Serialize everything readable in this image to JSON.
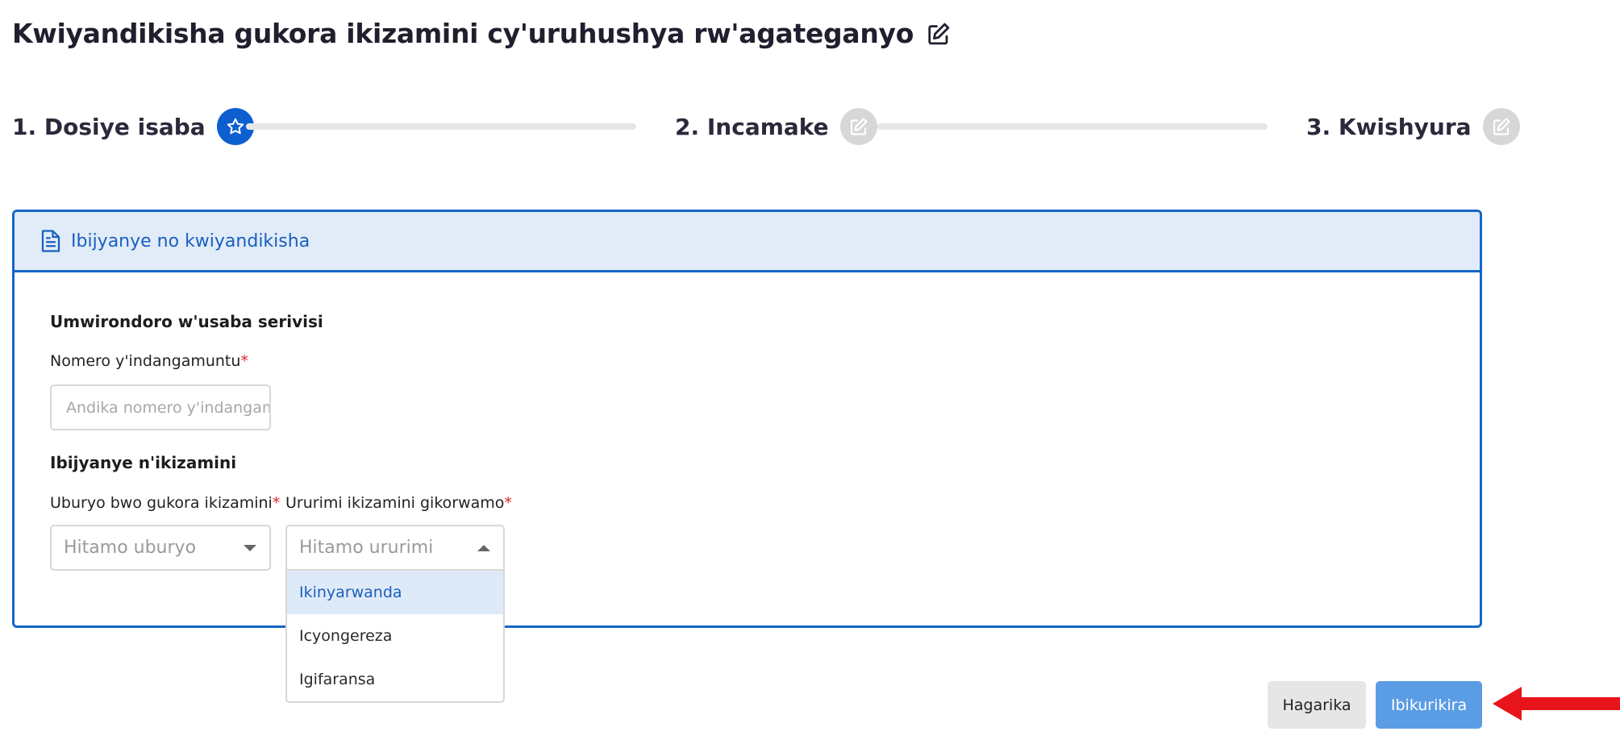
{
  "page": {
    "title": "Kwiyandikisha gukora ikizamini cy'uruhushya rw'agateganyo"
  },
  "stepper": {
    "steps": [
      {
        "label": "1. Dosiye isaba",
        "state": "active",
        "icon": "star-icon"
      },
      {
        "label": "2. Incamake",
        "state": "inactive",
        "icon": "edit-icon"
      },
      {
        "label": "3. Kwishyura",
        "state": "inactive",
        "icon": "edit-icon"
      }
    ]
  },
  "card": {
    "header_title": "Ibijyanye no kwiyandikisha",
    "header_icon": "document-icon",
    "profile_section_title": "Umwirondoro w'usaba serivisi",
    "id_number": {
      "label": "Nomero y'indangamuntu",
      "required_mark": "*",
      "placeholder": "Andika nomero y'indangamuntu",
      "value": ""
    },
    "exam_section_title": "Ibijyanye n'ikizamini",
    "exam_type": {
      "label": "Uburyo bwo gukora ikizamini",
      "required_mark": "*",
      "placeholder": "Hitamo uburyo"
    },
    "exam_language": {
      "label": "Ururimi ikizamini gikorwamo",
      "required_mark": "*",
      "placeholder": "Hitamo ururimi",
      "options": [
        "Ikinyarwanda",
        "Icyongereza",
        "Igifaransa"
      ],
      "highlighted_option": "Ikinyarwanda"
    }
  },
  "actions": {
    "cancel_label": "Hagarika",
    "continue_label": "Ibikurikira"
  },
  "colors": {
    "primary": "#0d5fd0",
    "card_border": "#1565c8",
    "card_header_bg": "#e1ecf8",
    "continue_button": "#5b9de5",
    "cancel_button": "#e6e6e6",
    "required": "#e0242c",
    "annotation_arrow": "#e8141b"
  }
}
